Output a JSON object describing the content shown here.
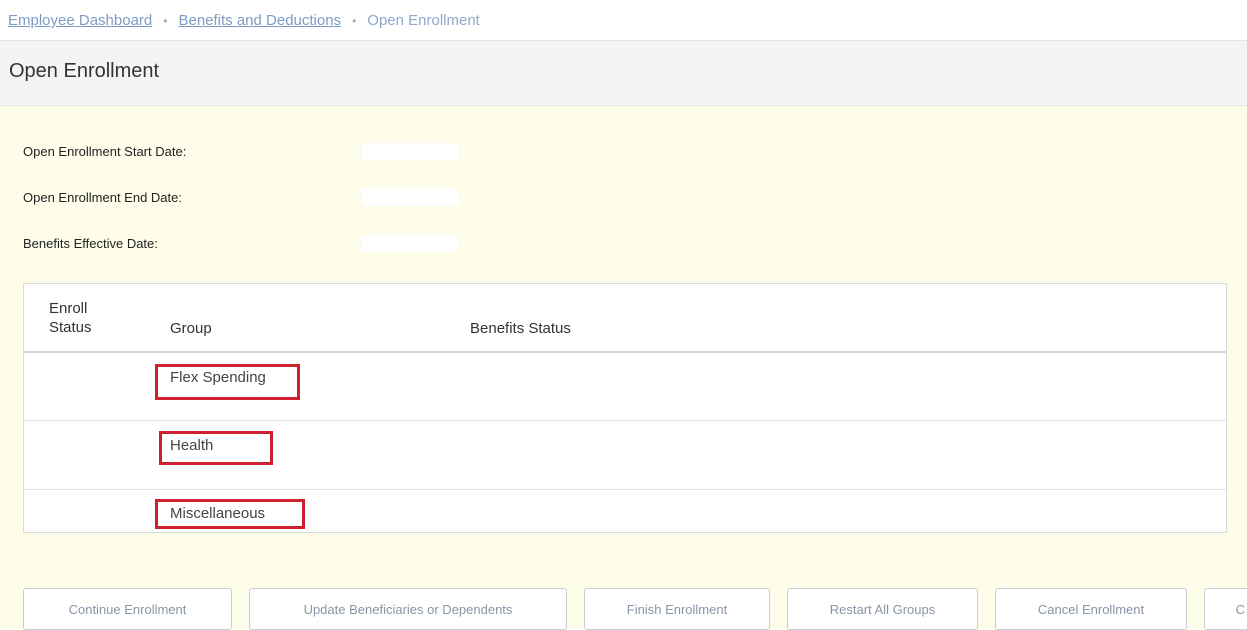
{
  "breadcrumb": {
    "items": [
      {
        "label": "Employee Dashboard"
      },
      {
        "label": "Benefits and Deductions"
      },
      {
        "label": "Open Enrollment"
      }
    ],
    "separator": "•"
  },
  "page": {
    "title": "Open Enrollment"
  },
  "info": {
    "start_date_label": "Open Enrollment Start Date:",
    "end_date_label": "Open Enrollment End Date:",
    "effective_date_label": "Benefits Effective Date:"
  },
  "table": {
    "headers": {
      "enroll_status": "Enroll Status",
      "group": "Group",
      "benefits_status": "Benefits Status"
    },
    "rows": [
      {
        "group": "Flex Spending"
      },
      {
        "group": "Health"
      },
      {
        "group": "Miscellaneous"
      }
    ]
  },
  "buttons": {
    "continue": "Continue Enrollment",
    "update": "Update Beneficiaries or Dependents",
    "finish": "Finish Enrollment",
    "restart": "Restart All Groups",
    "cancel": "Cancel Enrollment",
    "partial": "C"
  },
  "colors": {
    "highlight": "#d0222e",
    "panel_background": "#fdfde9",
    "link": "#7d9cc4"
  }
}
